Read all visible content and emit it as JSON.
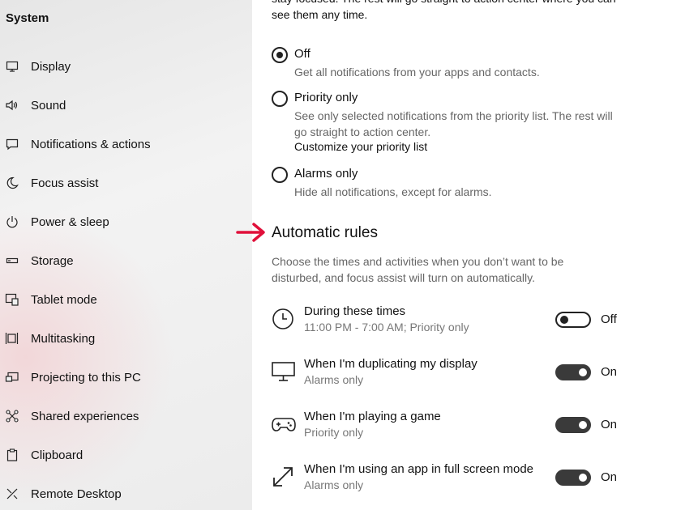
{
  "sidebar": {
    "title": "System",
    "items": [
      {
        "label": "Display",
        "icon": "monitor-icon"
      },
      {
        "label": "Sound",
        "icon": "speaker-icon"
      },
      {
        "label": "Notifications & actions",
        "icon": "message-icon"
      },
      {
        "label": "Focus assist",
        "icon": "moon-icon"
      },
      {
        "label": "Power & sleep",
        "icon": "power-icon"
      },
      {
        "label": "Storage",
        "icon": "storage-icon"
      },
      {
        "label": "Tablet mode",
        "icon": "tablet-icon"
      },
      {
        "label": "Multitasking",
        "icon": "multitasking-icon"
      },
      {
        "label": "Projecting to this PC",
        "icon": "projector-icon"
      },
      {
        "label": "Shared experiences",
        "icon": "share-icon"
      },
      {
        "label": "Clipboard",
        "icon": "clipboard-icon"
      },
      {
        "label": "Remote Desktop",
        "icon": "remote-desktop-icon"
      }
    ]
  },
  "main": {
    "intro": "stay focused. The rest will go straight to action center where you can see them any time.",
    "options": [
      {
        "label": "Off",
        "desc": "Get all notifications from your apps and contacts.",
        "checked": true
      },
      {
        "label": "Priority only",
        "desc": "See only selected notifications from the priority list. The rest will go straight to action center.",
        "link": "Customize your priority list",
        "checked": false
      },
      {
        "label": "Alarms only",
        "desc": "Hide all notifications, except for alarms.",
        "checked": false
      }
    ],
    "automatic_rules": {
      "title": "Automatic rules",
      "desc": "Choose the times and activities when you don’t want to be disturbed, and focus assist will turn on automatically.",
      "rules": [
        {
          "title": "During these times",
          "sub": "11:00 PM - 7:00 AM; Priority only",
          "state": "Off",
          "on": false,
          "icon": "clock-icon"
        },
        {
          "title": "When I'm duplicating my display",
          "sub": "Alarms only",
          "state": "On",
          "on": true,
          "icon": "monitor-icon"
        },
        {
          "title": "When I'm playing a game",
          "sub": "Priority only",
          "state": "On",
          "on": true,
          "icon": "gamepad-icon"
        },
        {
          "title": "When I'm using an app in full screen mode",
          "sub": "Alarms only",
          "state": "On",
          "on": true,
          "icon": "fullscreen-icon"
        }
      ]
    }
  },
  "colors": {
    "accent_arrow": "#e0103a",
    "toggle_on": "#3a3a3a"
  }
}
